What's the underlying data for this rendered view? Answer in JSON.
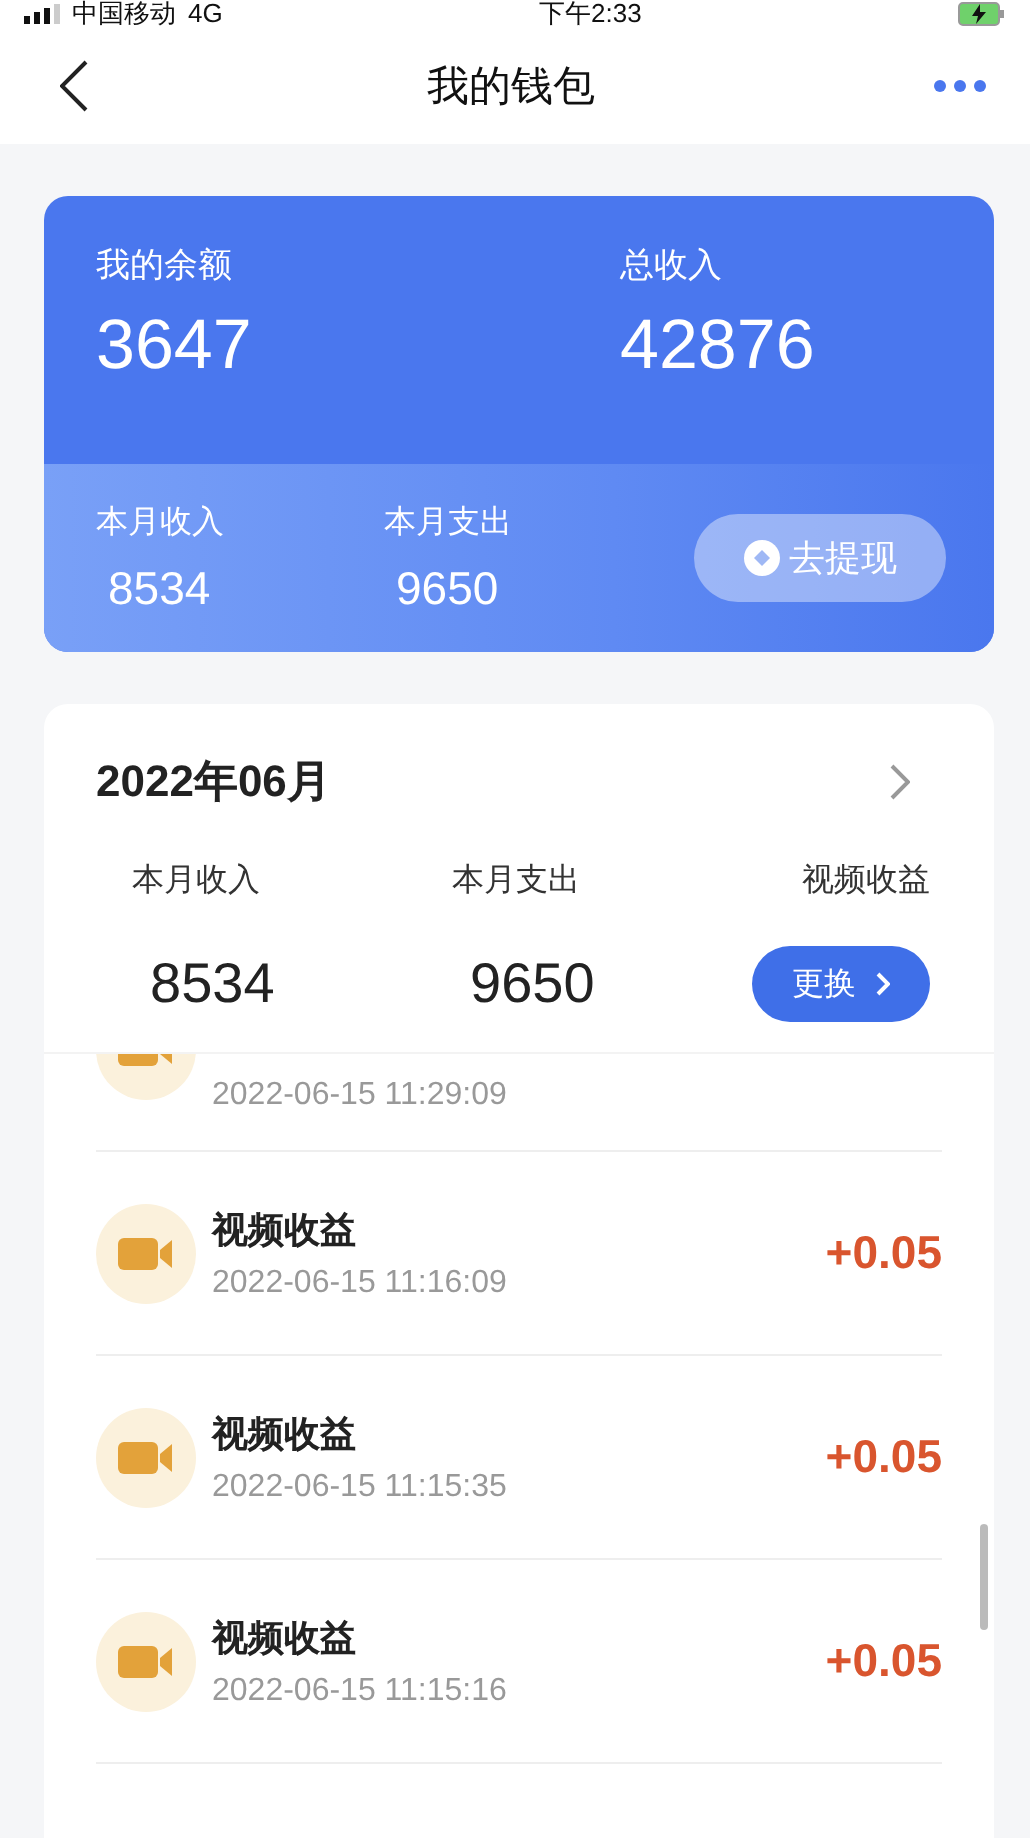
{
  "status_bar": {
    "carrier": "中国移动",
    "network": "4G",
    "time": "下午2:33"
  },
  "nav": {
    "title": "我的钱包"
  },
  "balance_card": {
    "balance_label": "我的余额",
    "balance": "3647",
    "total_label": "总收入",
    "total": "42876",
    "month": [
      {
        "label": "本月收入",
        "value": "8534"
      },
      {
        "label": "本月支出",
        "value": "9650"
      }
    ],
    "withdraw_button": "去提现"
  },
  "monthly": {
    "month": "2022年06月",
    "stats": [
      {
        "label": "本月收入",
        "value": "8534"
      },
      {
        "label": "本月支出",
        "value": "9650"
      }
    ],
    "filter_label": "视频收益",
    "switch_button": "更换"
  },
  "transactions": [
    {
      "date": "2022-06-15 11:29:09"
    },
    {
      "title": "视频收益",
      "date": "2022-06-15 11:16:09",
      "amount": "+0.05"
    },
    {
      "title": "视频收益",
      "date": "2022-06-15 11:15:35",
      "amount": "+0.05"
    },
    {
      "title": "视频收益",
      "date": "2022-06-15 11:15:16",
      "amount": "+0.05"
    }
  ]
}
